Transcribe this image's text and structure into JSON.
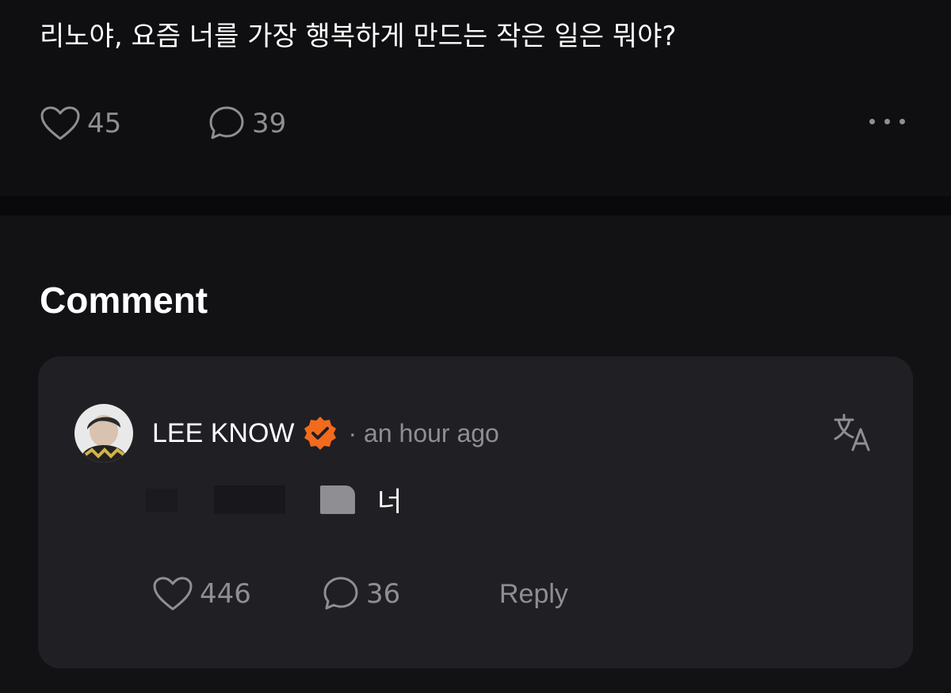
{
  "post": {
    "text": "리노야, 요즘 너를 가장 행복하게 만드는 작은 일은 뭐야?",
    "likes": "45",
    "comments": "39",
    "more_icon": "more-horizontal-icon"
  },
  "comments_section": {
    "title": "Comment"
  },
  "comment": {
    "author": "LEE KNOW",
    "verified_icon": "verified-badge-icon",
    "verified_color": "#f26b1d",
    "time": "· an hour ago",
    "translate_icon": "translate-icon",
    "text": "너",
    "likes": "446",
    "replies": "36",
    "reply_label": "Reply"
  },
  "colors": {
    "background": "#0f0f11",
    "card": "#1f1f24",
    "muted_text": "#8e8e93",
    "accent": "#f26b1d"
  }
}
